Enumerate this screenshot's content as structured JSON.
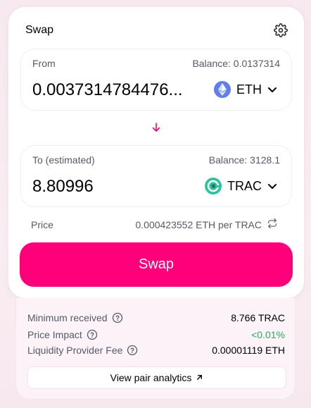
{
  "header": {
    "title": "Swap"
  },
  "from": {
    "label": "From",
    "balance": "Balance: 0.0137314",
    "amount": "0.0037314784476...",
    "token": {
      "symbol": "ETH",
      "icon": "ethereum-icon",
      "color": "#627eea"
    }
  },
  "to": {
    "label": "To (estimated)",
    "balance": "Balance: 3128.1",
    "amount": "8.80996",
    "token": {
      "symbol": "TRAC",
      "icon": "trac-icon",
      "color": "#2fc39a"
    }
  },
  "price": {
    "label": "Price",
    "value": "0.000423552 ETH per TRAC"
  },
  "swap_button": {
    "label": "Swap"
  },
  "details": {
    "rows": [
      {
        "label": "Minimum received",
        "value": "8.766 TRAC"
      },
      {
        "label": "Price Impact",
        "value": "<0.01%"
      },
      {
        "label": "Liquidity Provider Fee",
        "value": "0.00001119 ETH"
      }
    ],
    "analytics_label": "View pair analytics"
  },
  "colors": {
    "accent": "#ff007a",
    "positive": "#27ae60",
    "muted_text": "#565a69"
  }
}
